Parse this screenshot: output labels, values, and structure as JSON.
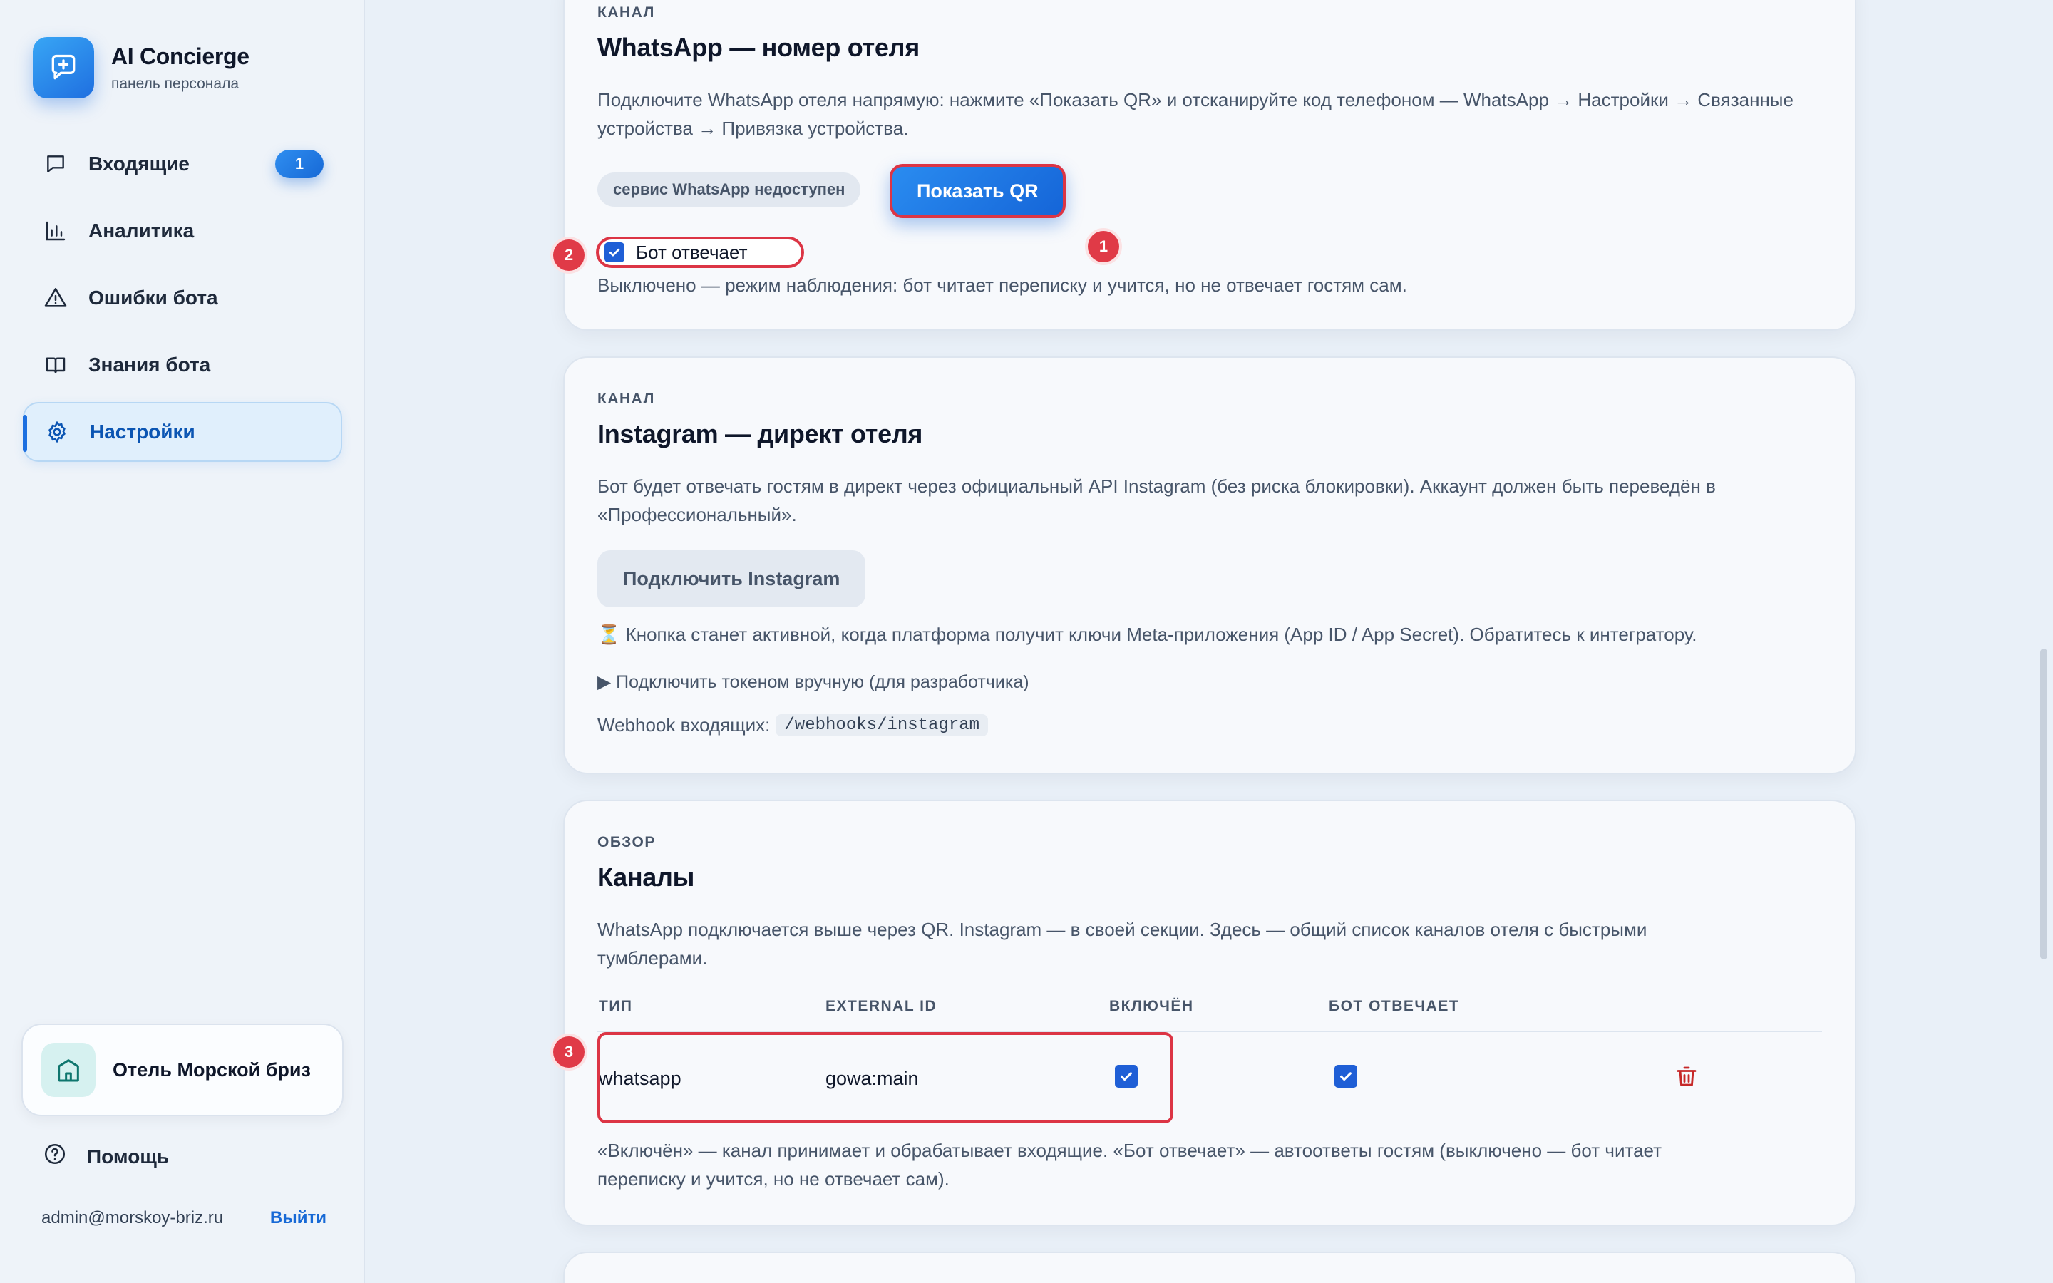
{
  "brand": {
    "title": "AI Concierge",
    "subtitle": "панель персонала"
  },
  "sidebar": {
    "items": [
      {
        "label": "Входящие",
        "icon": "chat-bubble-icon",
        "badge": "1"
      },
      {
        "label": "Аналитика",
        "icon": "bar-chart-icon"
      },
      {
        "label": "Ошибки бота",
        "icon": "warning-icon"
      },
      {
        "label": "Знания бота",
        "icon": "book-icon"
      },
      {
        "label": "Настройки",
        "icon": "gear-icon",
        "active": true
      }
    ],
    "hotel": {
      "name": "Отель Морской бриз",
      "icon": "hotel-icon"
    },
    "help": {
      "label": "Помощь",
      "icon": "help-icon"
    },
    "account": {
      "email": "admin@morskoy-briz.ru",
      "logout": "Выйти"
    }
  },
  "whatsapp": {
    "eyebrow": "КАНАЛ",
    "title": "WhatsApp — номер отеля",
    "description": "Подключите WhatsApp отеля напрямую: нажмите «Показать QR» и отсканируйте код телефоном — WhatsApp → Настройки → Связанные устройства → Привязка устройства.",
    "status_pill": "сервис WhatsApp недоступен",
    "show_qr_button": "Показать QR",
    "bot_replies_label": "Бот отвечает",
    "bot_replies_checked": true,
    "hint": "Выключено — режим наблюдения: бот читает переписку и учится, но не отвечает гостям сам."
  },
  "instagram": {
    "eyebrow": "КАНАЛ",
    "title": "Instagram — директ отеля",
    "description": "Бот будет отвечать гостям в директ через официальный API Instagram (без риска блокировки). Аккаунт должен быть переведён в «Профессиональный».",
    "connect_button": "Подключить Instagram",
    "pending_note": "⏳ Кнопка станет активной, когда платформа получит ключи Meta-приложения (App ID / App Secret). Обратитесь к интегратору.",
    "manual_token": "▶ Подключить токеном вручную (для разработчика)",
    "webhook_label": "Webhook входящих:",
    "webhook_path": "/webhooks/instagram"
  },
  "channels": {
    "eyebrow": "ОБЗОР",
    "title": "Каналы",
    "description": "WhatsApp подключается выше через QR. Instagram — в своей секции. Здесь — общий список каналов отеля с быстрыми тумблерами.",
    "columns": [
      "ТИП",
      "EXTERNAL ID",
      "ВКЛЮЧЁН",
      "БОТ ОТВЕЧАЕТ"
    ],
    "rows": [
      {
        "type": "whatsapp",
        "external_id": "gowa:main",
        "enabled": true,
        "bot_replies": true
      }
    ],
    "footnote": "«Включён» — канал принимает и обрабатывает входящие. «Бот отвечает» — автоответы гостям (выключено — бот читает переписку и учится, но не отвечает сам)."
  },
  "markers": [
    "1",
    "2",
    "3"
  ],
  "colors": {
    "accent": "#1769d6",
    "highlight": "#dc3545",
    "marker": "#e03a47",
    "delete": "#c62828"
  }
}
